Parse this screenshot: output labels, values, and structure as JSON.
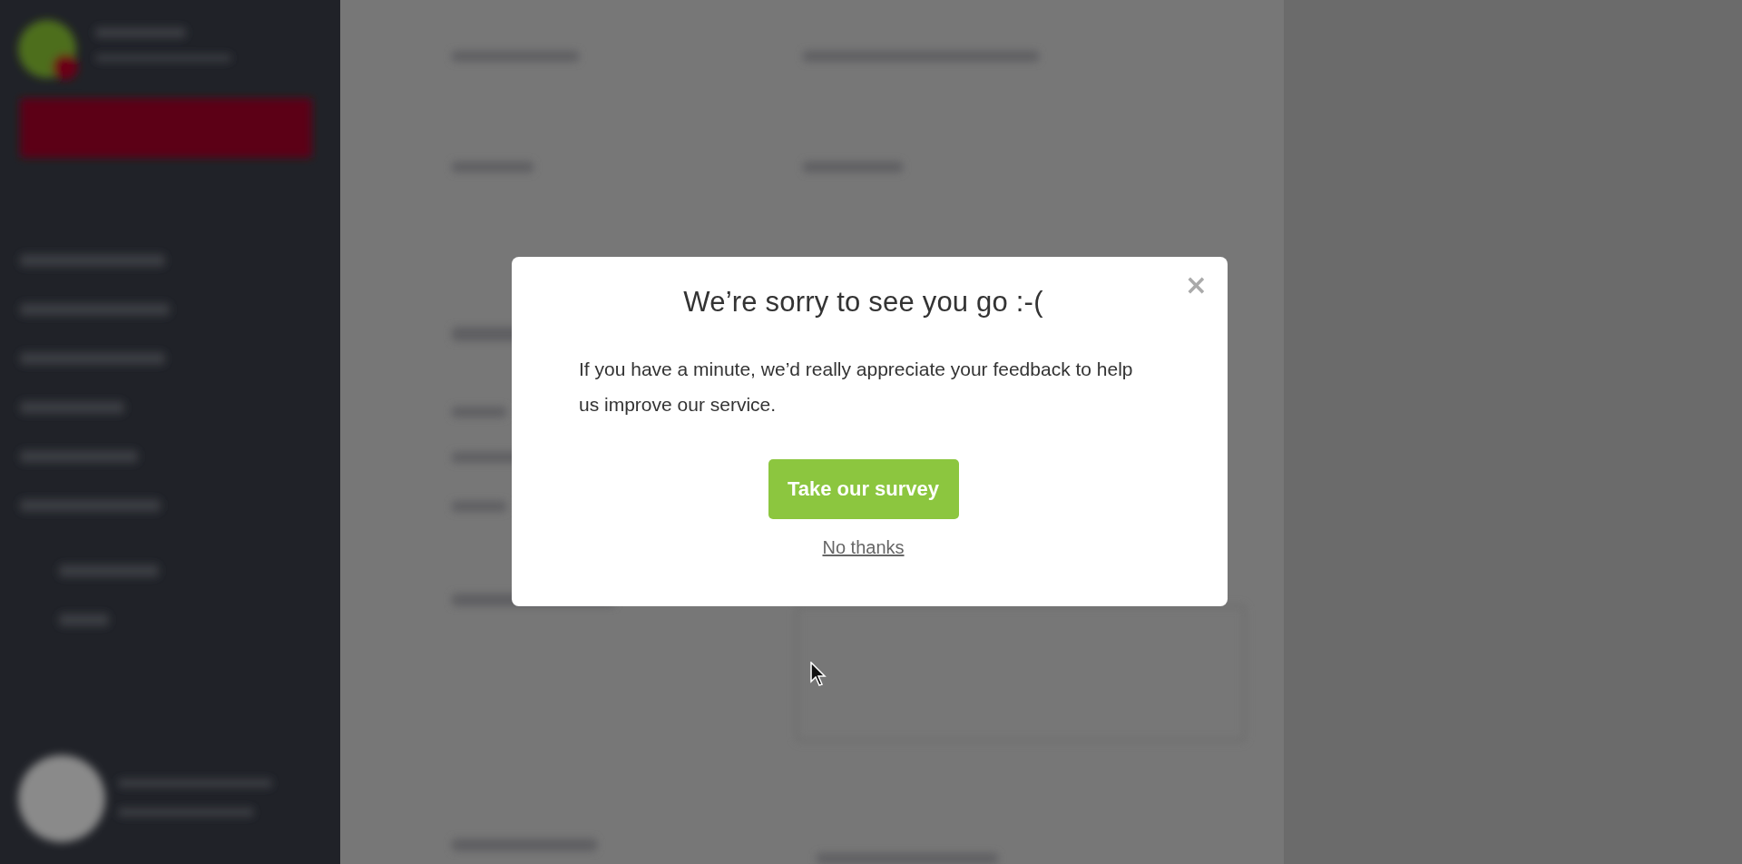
{
  "dialog": {
    "close": "×",
    "title": "We’re sorry to see you go :-(",
    "message": "If you have a minute, we’d really appreciate your feedback to help us improve our service.",
    "primary_button": "Take our survey",
    "secondary_link": "No thanks"
  }
}
